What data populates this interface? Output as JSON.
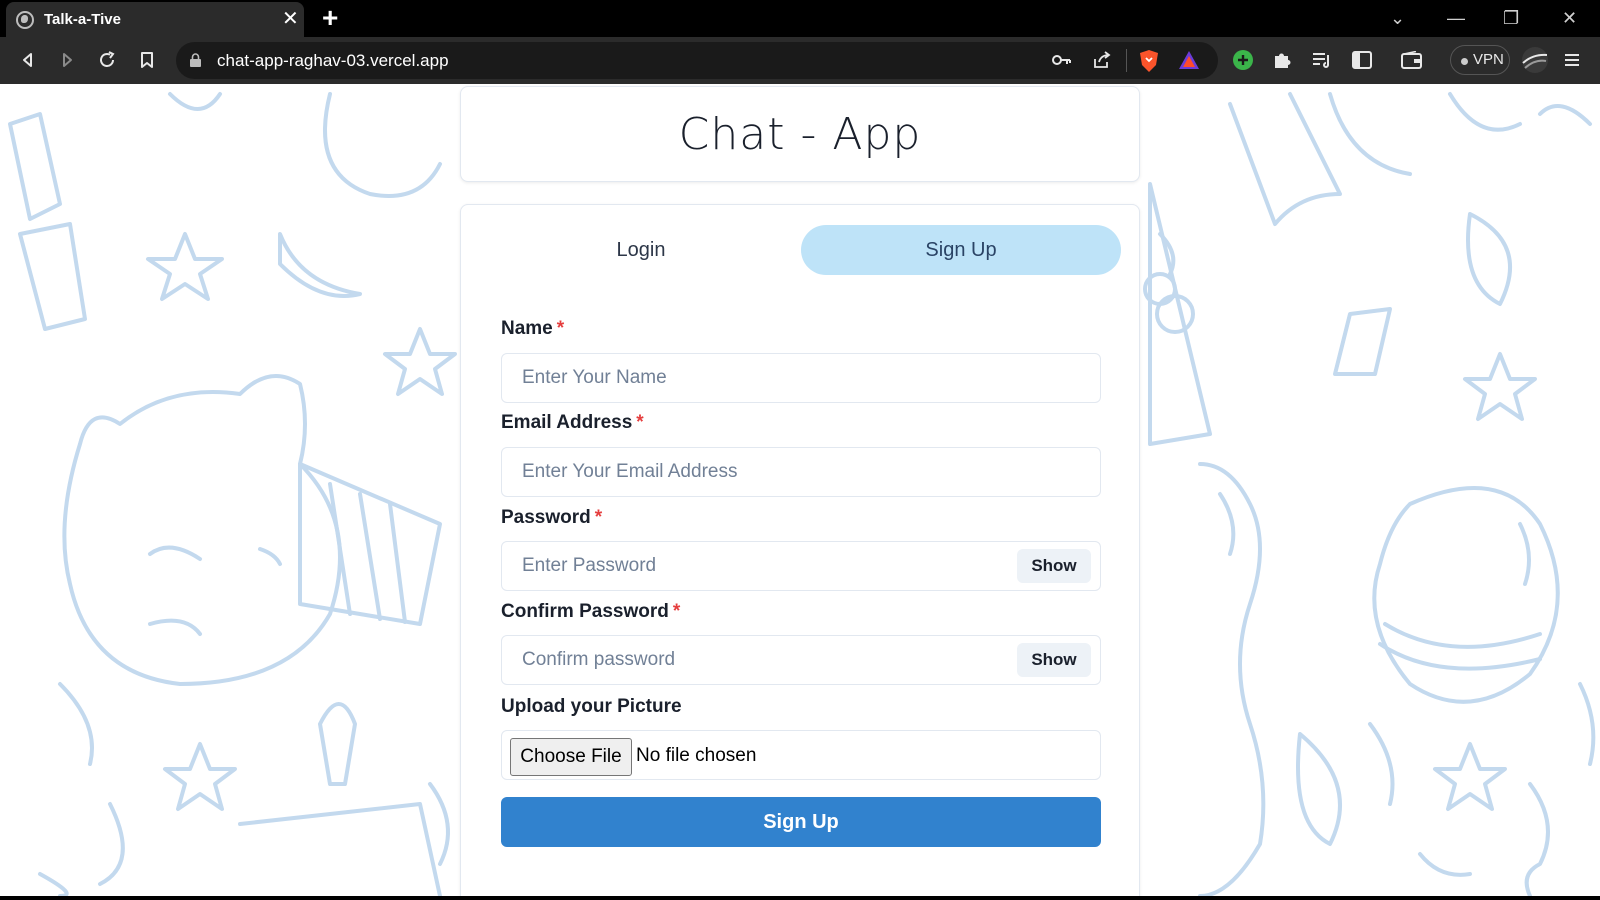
{
  "browser": {
    "tab_title": "Talk-a-Tive",
    "tab_close": "✕",
    "new_tab": "+",
    "url": "chat-app-raghav-03.vercel.app",
    "vpn_label": "VPN",
    "window_controls": [
      "⌄",
      "—",
      "❐",
      "✕"
    ]
  },
  "header": {
    "title": "Chat - App"
  },
  "tabs": {
    "login": "Login",
    "signup": "Sign Up"
  },
  "form": {
    "name": {
      "label": "Name",
      "required": "*",
      "placeholder": "Enter Your Name"
    },
    "email": {
      "label": "Email Address",
      "required": "*",
      "placeholder": "Enter Your Email Address"
    },
    "password": {
      "label": "Password",
      "required": "*",
      "placeholder": "Enter Password",
      "toggle": "Show"
    },
    "confirm_password": {
      "label": "Confirm Password",
      "required": "*",
      "placeholder": "Confirm password",
      "toggle": "Show"
    },
    "picture": {
      "label": "Upload your Picture",
      "button": "Choose File",
      "status": "No file chosen"
    },
    "submit": "Sign Up"
  },
  "colors": {
    "accent": "#3182ce",
    "active_tab": "#bee3f8",
    "pattern": "#c3d9ee",
    "required": "#e53e3e"
  }
}
